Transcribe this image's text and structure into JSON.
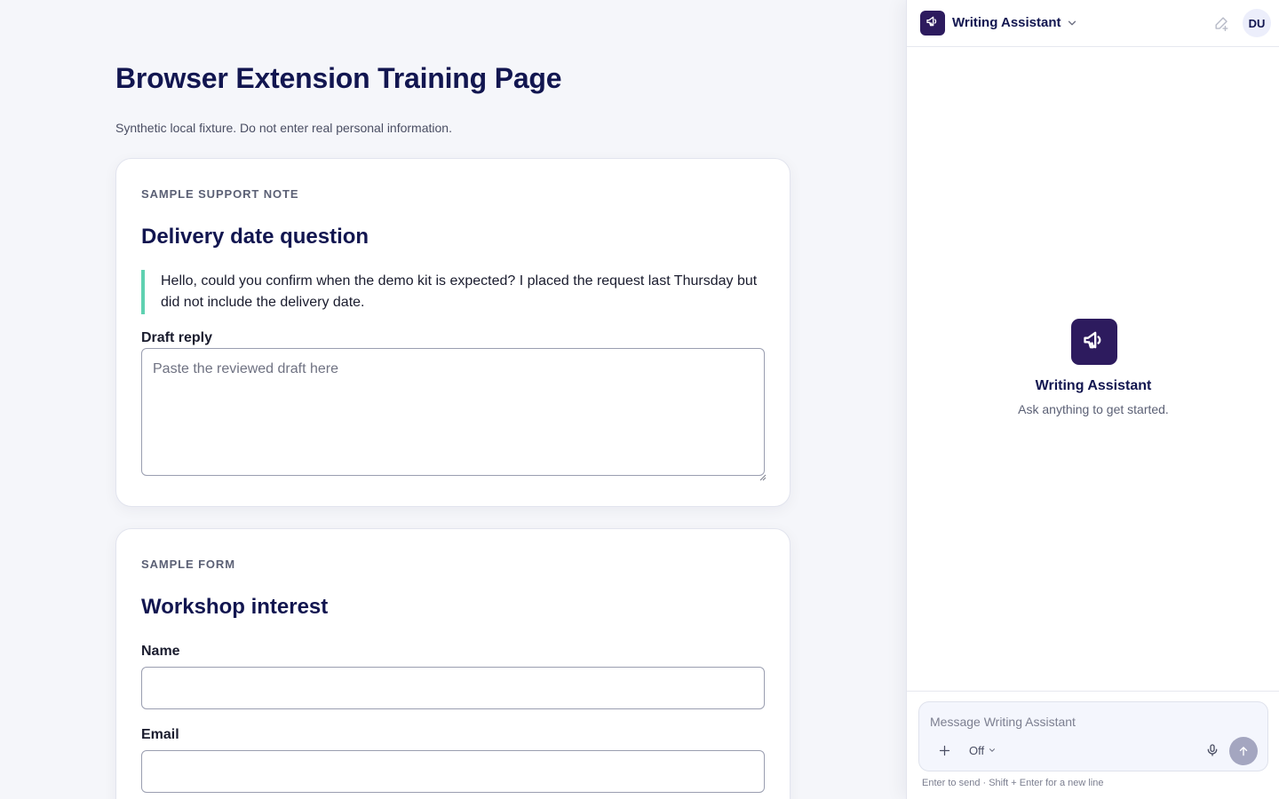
{
  "page": {
    "title": "Browser Extension Training Page",
    "subtitle": "Synthetic local fixture. Do not enter real personal information."
  },
  "support_card": {
    "eyebrow": "SAMPLE SUPPORT NOTE",
    "heading": "Delivery date question",
    "quote": "Hello, could you confirm when the demo kit is expected? I placed the request last Thursday but did not include the delivery date.",
    "draft_label": "Draft reply",
    "draft_placeholder": "Paste the reviewed draft here",
    "draft_value": ""
  },
  "form_card": {
    "eyebrow": "SAMPLE FORM",
    "heading": "Workshop interest",
    "name_label": "Name",
    "name_value": "",
    "email_label": "Email",
    "email_value": ""
  },
  "assistant": {
    "header_title": "Writing Assistant",
    "header_icon": "megaphone-icon",
    "avatar_initials": "DU",
    "empty_title": "Writing Assistant",
    "empty_subtitle": "Ask anything to get started.",
    "composer_placeholder": "Message Writing Assistant",
    "mode_value": "Off",
    "hint": "Enter to send · Shift + Enter for a new line"
  },
  "colors": {
    "brand": "#2d1b5e",
    "title": "#121650",
    "quote_accent": "#5fd1b1",
    "send_disabled": "#a4a6c0"
  }
}
